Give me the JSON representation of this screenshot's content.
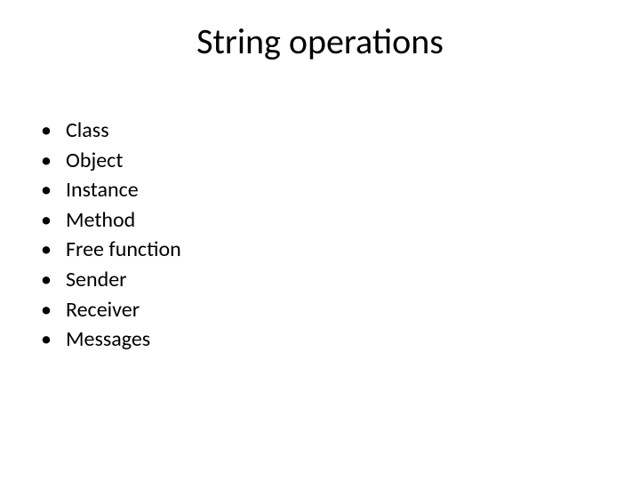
{
  "title": "String operations",
  "bullets": {
    "b0": "Class",
    "b1": "Object",
    "b2": "Instance",
    "b3": "Method",
    "b4": "Free function",
    "b5": "Sender",
    "b6": "Receiver",
    "b7": "Messages"
  }
}
